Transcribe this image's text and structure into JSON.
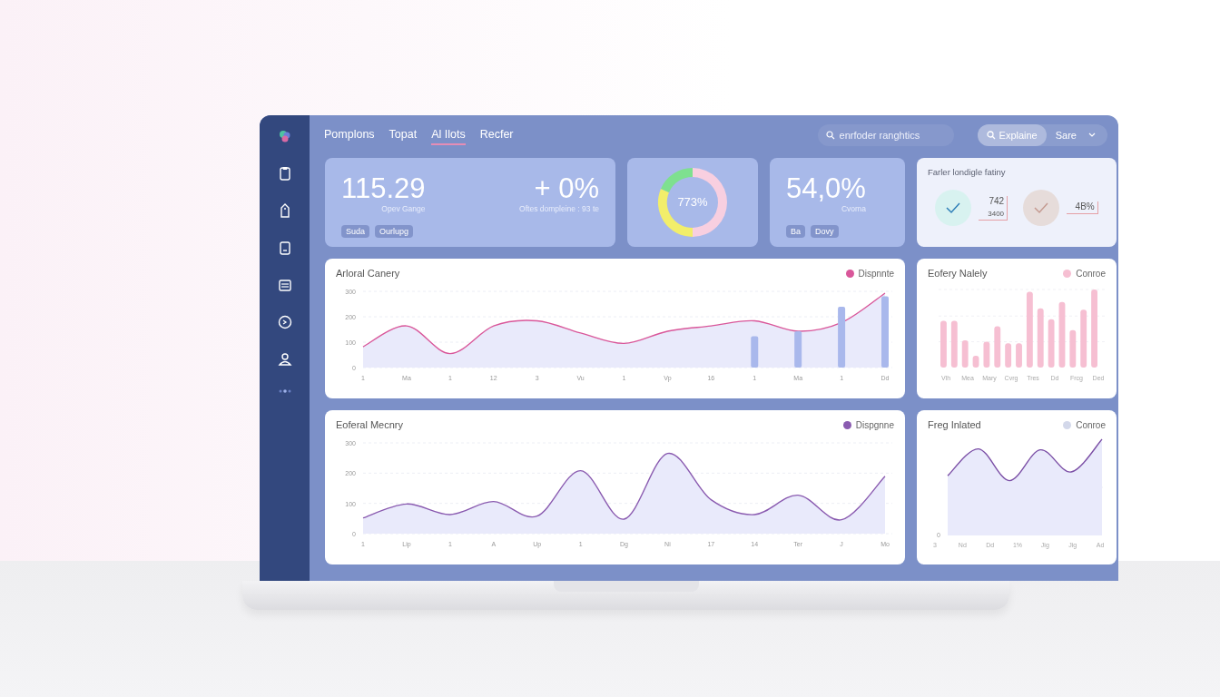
{
  "tabs": [
    {
      "label": "Pomplons",
      "selected": false
    },
    {
      "label": "Topat",
      "selected": false
    },
    {
      "label": "Al Ilots",
      "selected": true
    },
    {
      "label": "Recfer",
      "selected": false
    }
  ],
  "search": {
    "placeholder": "enrfoder ranghtics"
  },
  "buttons": [
    {
      "label": "Explaine",
      "kind": "search"
    },
    {
      "label": "Sare",
      "kind": "dropdown"
    }
  ],
  "kpis": [
    {
      "kind": "stat",
      "value": "115.29",
      "caption": "Opev Gange",
      "change": "+ 0%",
      "change_caption": "Oftes dompleine : 93 te",
      "tags": [
        "Suda",
        "Ourlupg"
      ]
    },
    {
      "kind": "donut",
      "value": "773%"
    },
    {
      "kind": "stat",
      "value": "54,0%",
      "caption": "Cvoma",
      "tags": [
        "Ba",
        "Dovy"
      ]
    },
    {
      "kind": "checks",
      "title": "Farler londigle fatiny",
      "items": [
        {
          "color": "#d8f2f0",
          "values": [
            "742",
            "3400"
          ]
        },
        {
          "color": "#e6dcda",
          "values": [
            "4B%"
          ]
        }
      ]
    }
  ],
  "charts": [
    {
      "kind": "main",
      "chart_data": {
        "type": "area",
        "title": "Arloral Canery",
        "categories": [
          "1",
          "Ma",
          "1",
          "12",
          "3",
          "Vu",
          "1",
          "Vp",
          "16",
          "1",
          "Ma",
          "1",
          "Dd"
        ],
        "ylim": [
          0,
          300
        ],
        "yticks": [
          0,
          100,
          200,
          300
        ],
        "series": [
          {
            "name": "Dispnnte",
            "color": "#d9579a",
            "values": [
              82,
              164,
              55,
              164,
              184,
              136,
              95,
              143,
              164,
              184,
              143,
              177,
              293
            ]
          },
          {
            "type": "bar",
            "color": "#a9b8ec",
            "values": [
              null,
              null,
              null,
              null,
              null,
              null,
              null,
              null,
              null,
              123,
              143,
              239,
              280
            ]
          }
        ]
      }
    },
    {
      "kind": "side-bars",
      "title": "Eofery Nalely",
      "legend": {
        "label": "Conroe",
        "color": "#f6bfd2"
      },
      "x_labels": [
        "Vlh",
        "Mea",
        "Mary",
        "Cvrg",
        "Tres",
        "Dd",
        "Frcg",
        "Ded"
      ]
    },
    {
      "kind": "main",
      "chart_data": {
        "type": "area",
        "title": "Eoferal Mecnry",
        "categories": [
          "1",
          "Lip",
          "1",
          "A",
          "Up",
          "1",
          "Dg",
          "Ni",
          "17",
          "14",
          "Ter",
          "J",
          "Mo"
        ],
        "ylim": [
          0,
          300
        ],
        "yticks": [
          0,
          100,
          200,
          300
        ],
        "series": [
          {
            "name": "Dispgnne",
            "color": "#8a5bb0",
            "values": [
              52,
              98,
              63,
              106,
              58,
              208,
              48,
              265,
              112,
              63,
              127,
              46,
              190
            ]
          }
        ]
      }
    },
    {
      "kind": "side-area",
      "title": "Freg Inlated",
      "legend": {
        "label": "Conroe",
        "color": "#d3d8ea"
      },
      "y_labels": [
        "0"
      ],
      "x_labels": [
        "3",
        "Nd",
        "Dd",
        "1%",
        "Jig",
        "Jig",
        "Ad"
      ]
    }
  ]
}
